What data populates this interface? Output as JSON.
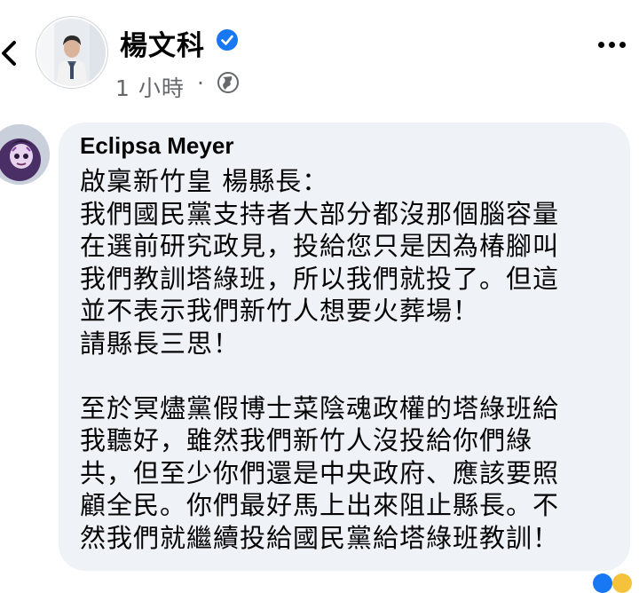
{
  "post": {
    "author_name": "楊文科",
    "timestamp": "1 小時",
    "separator": "·",
    "icons": {
      "back": "chevron-left-icon",
      "verified": "verified-badge-icon",
      "audience": "globe-icon",
      "more": "more-horizontal-icon"
    }
  },
  "comment": {
    "author_name": "Eclipsa Meyer",
    "paragraph_1": [
      "啟稟新竹皇 楊縣長：",
      "我們國民黨支持者大部分都沒那個腦容量",
      "在選前研究政見，投給您只是因為椿腳叫",
      "我們教訓塔綠班，所以我們就投了。但這",
      "並不表示我們新竹人想要火葬場！",
      "請縣長三思！"
    ],
    "paragraph_2": [
      "至於冥燼黨假博士菜陰魂政權的塔綠班給",
      "我聽好，雖然我們新竹人沒投給你們綠",
      "共，但至少你們還是中央政府、應該要照",
      "顧全民。你們最好馬上出來阻止縣長。不",
      "然我們就繼續投給國民黨給塔綠班教訓！"
    ]
  },
  "colors": {
    "background": "#ffffff",
    "bubble": "#eff2f6",
    "primary_text": "#050505",
    "secondary_text": "#65676b",
    "verified_blue": "#1877f2"
  }
}
